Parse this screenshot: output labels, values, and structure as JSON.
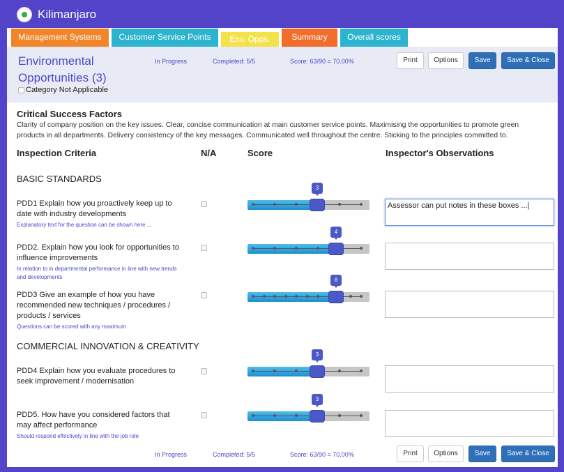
{
  "app": {
    "title": "Kilimanjaro"
  },
  "tabs": [
    {
      "label": "Management Systems",
      "color": "#f2852a"
    },
    {
      "label": "Customer Service Points",
      "color": "#2cb3cf"
    },
    {
      "label": "Env. Opps.",
      "color": "#f4e24a"
    },
    {
      "label": "Summary",
      "color": "#f26d2a"
    },
    {
      "label": "Overall scores",
      "color": "#2cb3cf"
    }
  ],
  "header": {
    "title": "Environmental Opportunities (3)",
    "category_na": "Category Not Applicable",
    "status": "In Progress",
    "completed": "Completed: 5/5",
    "score": "Score: 63/90 = 70.00%"
  },
  "buttons": {
    "print": "Print",
    "options": "Options",
    "save": "Save",
    "save_close": "Save & Close"
  },
  "csf": {
    "heading": "Critical Success Factors",
    "text": "Clarity of company position on the key issues. Clear, concise communication at main customer service points. Maximising the opportunities to promote green products in all departments. Delivery consistency of the key messages. Communicated well throughout the centre. Sticking to the principles committed to."
  },
  "columns": {
    "criteria": "Inspection Criteria",
    "na": "N/A",
    "score": "Score",
    "observations": "Inspector's Observations"
  },
  "sections": [
    {
      "title": "BASIC STANDARDS"
    },
    {
      "title": "COMMERCIAL INNOVATION & CREATIVITY"
    }
  ],
  "questions": [
    {
      "text": "PDD1 Explain how you proactively keep up to date with industry developments",
      "note": "Explanatory text for the question can be shown here ...",
      "score": 3,
      "max": 5,
      "observation": "Assessor can put notes in these boxes ...|"
    },
    {
      "text": "PDD2. Explain how you look for opportunities to influence improvements",
      "note": "In relation to in departmental performance in line with new trends and developments",
      "score": 4,
      "max": 5,
      "observation": ""
    },
    {
      "text": "PDD3 Give an example of how you have recommended new techniques / procedures / products / services",
      "note": "Questions can be scored with any maximum",
      "score": 8,
      "max": 10,
      "observation": ""
    },
    {
      "text": "PDD4 Explain how you evaluate procedures to seek improvement / modernisation",
      "note": "",
      "score": 3,
      "max": 5,
      "observation": ""
    },
    {
      "text": "PDD5. How have you considered factors that may affect performance",
      "note": "Should respond effectively in line with the job role",
      "score": 3,
      "max": 5,
      "observation": ""
    }
  ],
  "colors": {
    "frame": "#5243c9",
    "accent": "#4b4ac7",
    "button": "#2f6fb8"
  }
}
